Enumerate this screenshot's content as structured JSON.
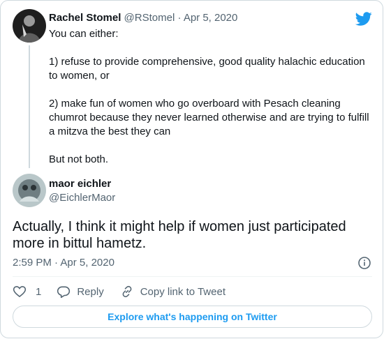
{
  "colors": {
    "twitter_blue": "#1d9bf0",
    "text_primary": "#0f1419",
    "text_secondary": "#536471",
    "border": "#cfd9de"
  },
  "parent_tweet": {
    "author_name": "Rachel Stomel",
    "author_handle": "@RStomel",
    "date": "Apr 5, 2020",
    "separator": "·",
    "avatar_icon": "user-avatar",
    "lines": [
      "You can either:",
      "1) refuse to provide comprehensive, good quality halachic education",
      "to women, or",
      "2) make fun of women who go overboard with Pesach cleaning",
      "chumrot because they never learned otherwise and are trying to fulfill",
      "a mitzva the best they can",
      "But not both."
    ]
  },
  "reply_tweet": {
    "author_name": "maor eichler",
    "author_handle": "@EichlerMaor",
    "avatar_icon": "user-avatar",
    "text_lines": [
      "Actually, I think it might help if women just participated",
      "more in bittul hametz."
    ],
    "time": "2:59 PM",
    "date": "Apr 5, 2020",
    "separator": "·"
  },
  "actions": {
    "like_count": "1",
    "reply_label": "Reply",
    "copy_link_label": "Copy link to Tweet"
  },
  "footer": {
    "explore_label": "Explore what's happening on Twitter"
  },
  "icons": [
    "twitter-bird-icon",
    "info-icon",
    "heart-icon",
    "reply-bubble-icon",
    "link-icon"
  ]
}
